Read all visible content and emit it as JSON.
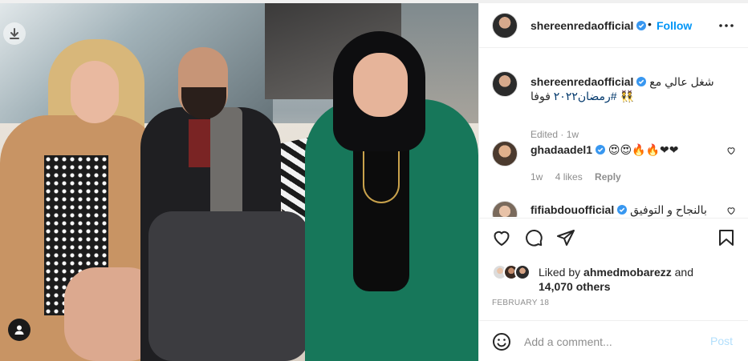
{
  "post": {
    "username": "shereenredaofficial",
    "follow_label": "Follow",
    "separator": "•"
  },
  "caption": {
    "username": "shereenredaofficial",
    "text_ar": "شغل عالي مع",
    "text_ar2": "فوفا",
    "hashtag": "#رمضان٢٠٢٢",
    "emoji": "👯",
    "edited_label": "Edited",
    "time": "1w"
  },
  "comments": [
    {
      "username": "ghadaadel1",
      "text": "😍😍🔥🔥❤❤",
      "time": "1w",
      "likes": "4 likes",
      "reply_label": "Reply"
    },
    {
      "username": "fifiabdouofficial",
      "text": "بالنجاح و التوفيق"
    }
  ],
  "likes": {
    "prefix": "Liked by",
    "user": "ahmedmobarezz",
    "and": "and",
    "others": "14,070 others"
  },
  "date": "FEBRUARY 18",
  "add_comment": {
    "placeholder": "Add a comment...",
    "post_label": "Post"
  },
  "colors": {
    "accent": "#0095f6",
    "verified": "#3897f0",
    "muted": "#8e8e8e",
    "hashtag": "#00376b",
    "post_disabled": "#b2dffc"
  },
  "icons": [
    "download-icon",
    "user-tag-icon",
    "more-icon",
    "verified-icon",
    "heart-icon",
    "comment-icon",
    "share-icon",
    "bookmark-icon",
    "emoji-icon"
  ]
}
